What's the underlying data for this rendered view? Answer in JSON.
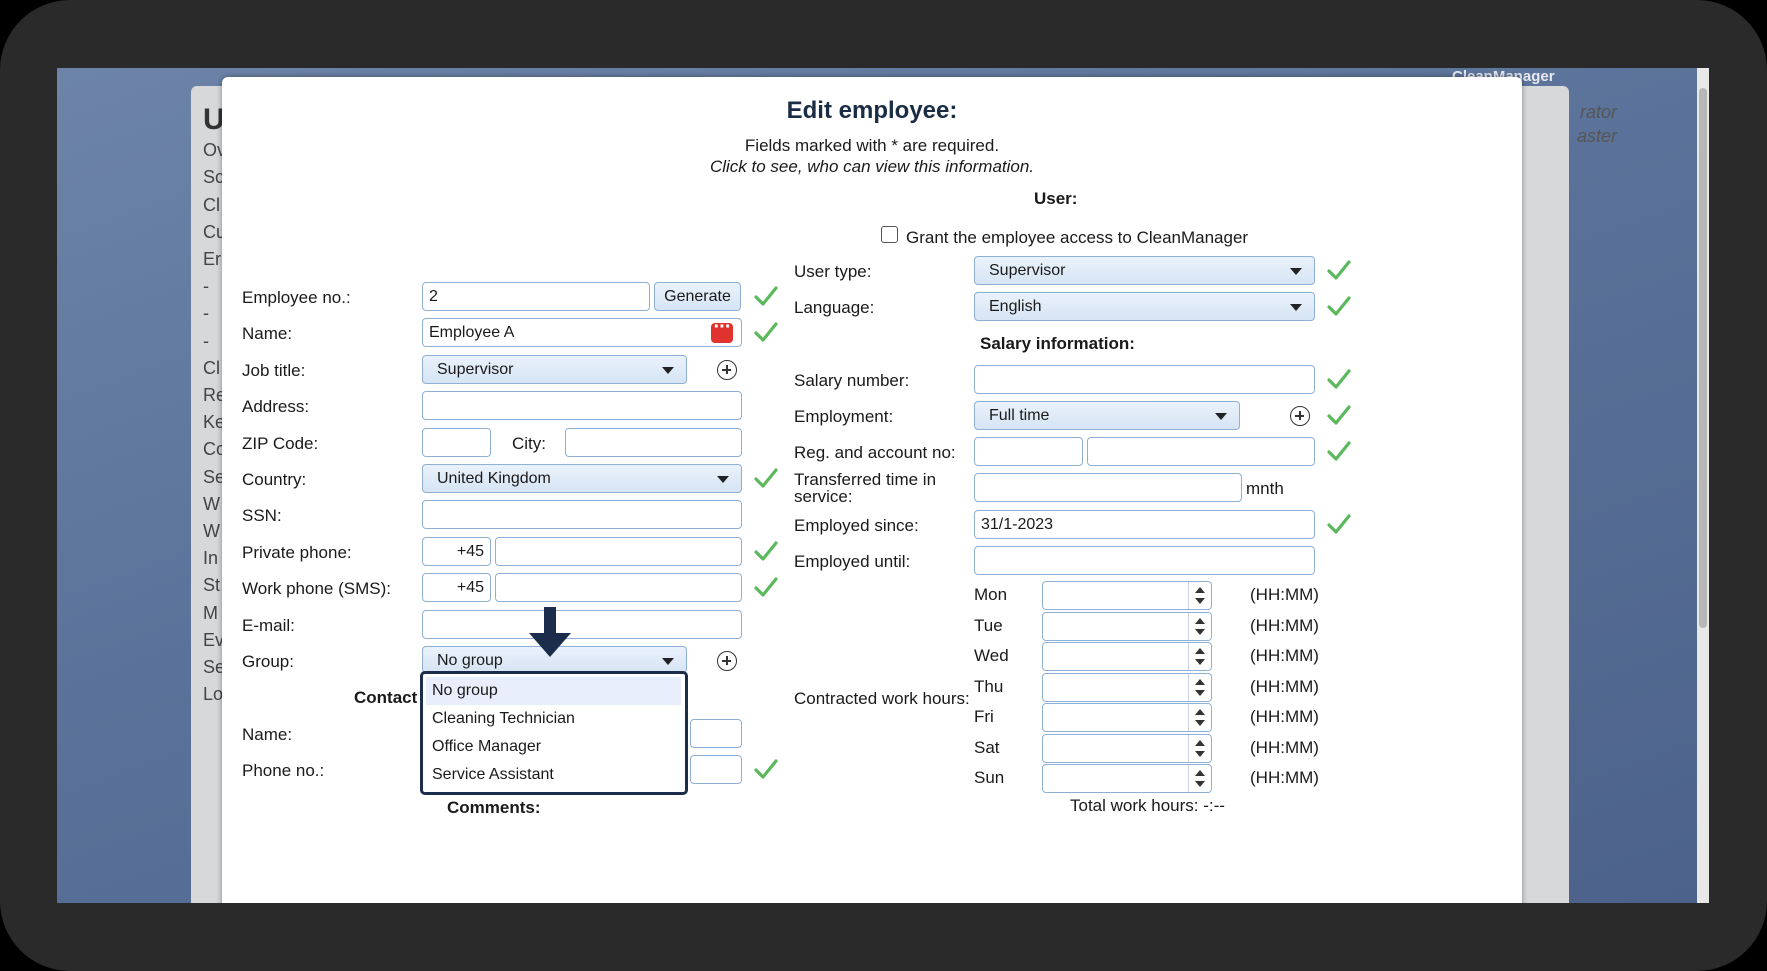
{
  "app": {
    "title": "CleanManager"
  },
  "background": {
    "heading_letter": "U",
    "left_items": [
      "Ov",
      "Sc",
      "Cl",
      "Cu",
      "Er",
      "-",
      "-",
      "-",
      "Cl",
      "Re",
      "Ke",
      "Co",
      "Se",
      "W",
      "W",
      "In",
      "St",
      "M",
      "Ev",
      "Se",
      "Lo"
    ],
    "right_texts": [
      "rator",
      "aster"
    ]
  },
  "dialog": {
    "title": "Edit employee:",
    "subtitle": "Fields marked with * are required.",
    "visibility_link": "Click to see, who can view this information."
  },
  "left": {
    "employee_no": {
      "label": "Employee no.:",
      "value": "2",
      "generate_label": "Generate"
    },
    "name": {
      "label": "Name:",
      "value": "Employee A"
    },
    "job_title": {
      "label": "Job title:",
      "value": "Supervisor"
    },
    "address": {
      "label": "Address:",
      "value": ""
    },
    "zip": {
      "label": "ZIP Code:",
      "value": ""
    },
    "city": {
      "label": "City:",
      "value": ""
    },
    "country": {
      "label": "Country:",
      "value": "United Kingdom"
    },
    "ssn": {
      "label": "SSN:",
      "value": ""
    },
    "private_phone": {
      "label": "Private phone:",
      "code": "+45",
      "value": ""
    },
    "work_phone": {
      "label": "Work phone (SMS):",
      "code": "+45",
      "value": ""
    },
    "email": {
      "label": "E-mail:",
      "value": ""
    },
    "group": {
      "label": "Group:",
      "value": "No group",
      "options": [
        "No group",
        "Cleaning Technician",
        "Office Manager",
        "Service Assistant"
      ]
    },
    "contact_heading": "Contact",
    "contact_name": {
      "label": "Name:"
    },
    "contact_phone": {
      "label": "Phone no.:"
    },
    "comments_heading": "Comments:"
  },
  "right": {
    "user_heading": "User:",
    "grant_access": {
      "label": "Grant the employee access to CleanManager",
      "checked": false
    },
    "user_type": {
      "label": "User type:",
      "value": "Supervisor"
    },
    "language": {
      "label": "Language:",
      "value": "English"
    },
    "salary_heading": "Salary information:",
    "salary_number": {
      "label": "Salary number:",
      "value": ""
    },
    "employment": {
      "label": "Employment:",
      "value": "Full time"
    },
    "reg_account": {
      "label": "Reg. and account no:"
    },
    "transferred": {
      "label_line1": "Transferred time in",
      "label_line2": "service:",
      "unit": "mnth"
    },
    "employed_since": {
      "label": "Employed since:",
      "value": "31/1-2023"
    },
    "employed_until": {
      "label": "Employed until:",
      "value": ""
    },
    "contracted_label": "Contracted work hours:",
    "days": [
      {
        "day": "Mon",
        "unit": "(HH:MM)"
      },
      {
        "day": "Tue",
        "unit": "(HH:MM)"
      },
      {
        "day": "Wed",
        "unit": "(HH:MM)"
      },
      {
        "day": "Thu",
        "unit": "(HH:MM)"
      },
      {
        "day": "Fri",
        "unit": "(HH:MM)"
      },
      {
        "day": "Sat",
        "unit": "(HH:MM)"
      },
      {
        "day": "Sun",
        "unit": "(HH:MM)"
      }
    ],
    "total_hours": "Total work hours: -:--"
  },
  "colors": {
    "accent": "#1b2d4a",
    "check": "#5cb85c",
    "field_border": "#8fb0d6"
  },
  "icons": {
    "check": "check-icon",
    "add": "plus-circle-icon",
    "password": "password-manager-icon",
    "arrow": "arrow-down-icon"
  }
}
